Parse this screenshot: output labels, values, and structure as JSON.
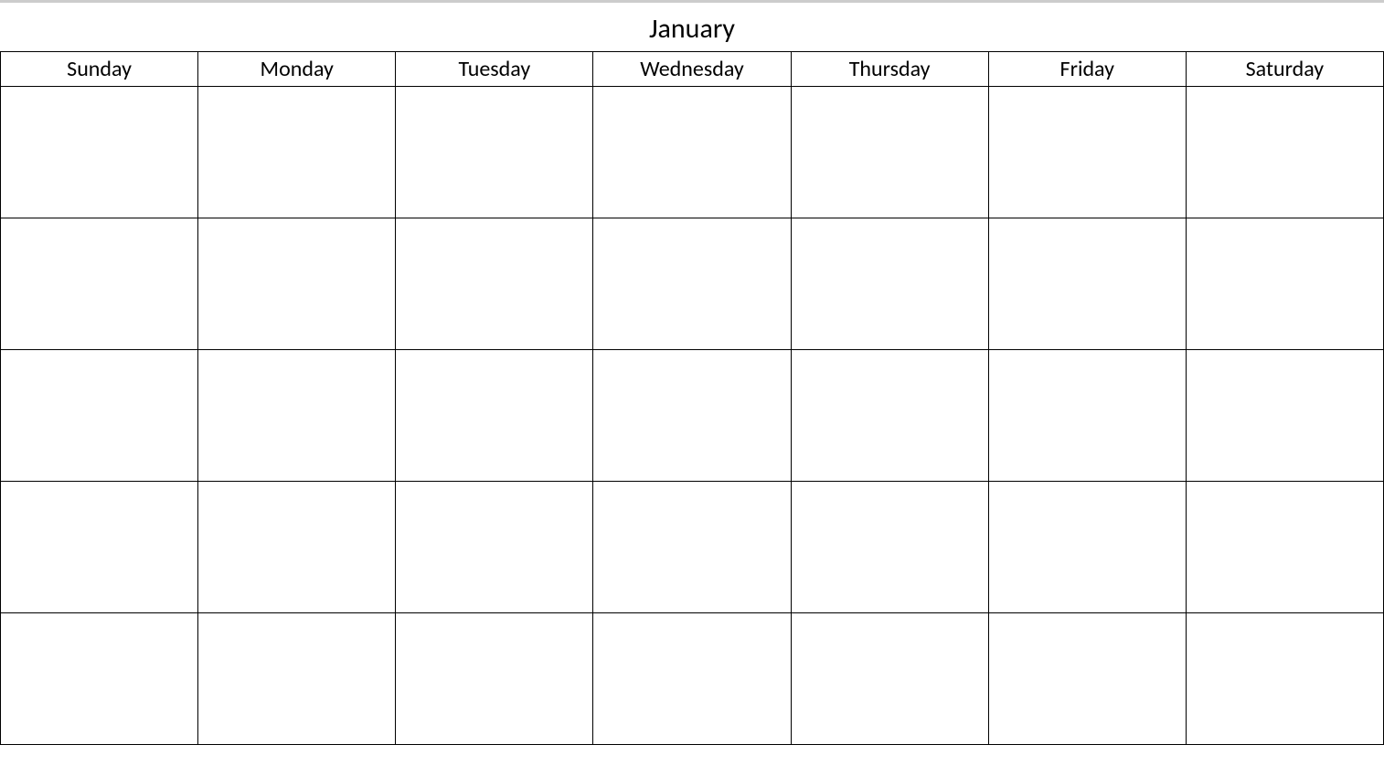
{
  "calendar": {
    "month": "January",
    "days": [
      "Sunday",
      "Monday",
      "Tuesday",
      "Wednesday",
      "Thursday",
      "Friday",
      "Saturday"
    ],
    "weeks": 5
  }
}
